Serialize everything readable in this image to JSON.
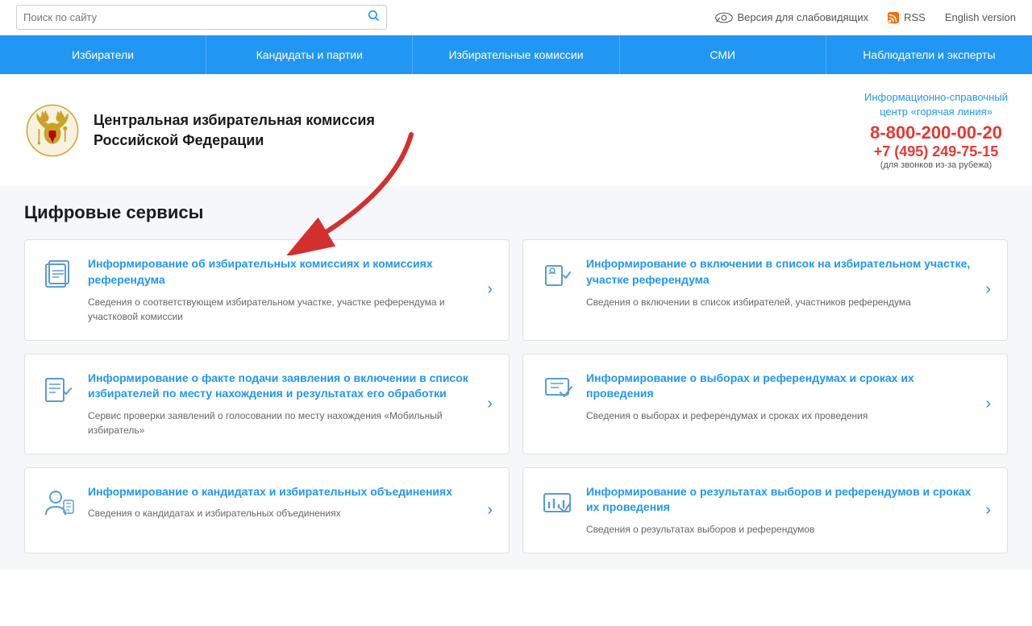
{
  "topbar": {
    "search_placeholder": "Поиск по сайту",
    "vision_label": "Версия для слабовидящих",
    "rss_label": "RSS",
    "english_label": "English version"
  },
  "nav": {
    "items": [
      {
        "label": "Избиратели"
      },
      {
        "label": "Кандидаты и партии"
      },
      {
        "label": "Избирательные комиссии"
      },
      {
        "label": "СМИ"
      },
      {
        "label": "Наблюдатели и эксперты"
      }
    ]
  },
  "header": {
    "org_name_line1": "Центральная избирательная комиссия",
    "org_name_line2": "Российской Федерации",
    "info_center_label": "Информационно-справочный\nцентр «горячая линия»",
    "phone1": "8-800-200-00-20",
    "phone2": "+7 (495) 249-75-15",
    "phone_note": "(для звонков из-за рубежа)"
  },
  "main": {
    "section_title": "Цифровые сервисы",
    "services": [
      {
        "id": "commission-info",
        "title": "Информирование об избирательных комиссиях и комиссиях референдума",
        "desc": "Сведения о соответствующем избирательном участке, участке референдума и участковой комиссии"
      },
      {
        "id": "voter-list-info",
        "title": "Информирование о включении в список на избирательном участке, участке референдума",
        "desc": "Сведения о включении в список избирателей, участников референдума"
      },
      {
        "id": "application-info",
        "title": "Информирование о факте подачи заявления о включении в список избирателей по месту нахождения и результатах его обработки",
        "desc": "Сервис проверки заявлений о голосовании по месту нахождения «Мобильный избиратель»"
      },
      {
        "id": "elections-info",
        "title": "Информирование о выборах и референдумах и сроках их проведения",
        "desc": "Сведения о выборах и референдумах и сроках их проведения"
      },
      {
        "id": "candidates-info",
        "title": "Информирование о кандидатах и избирательных объединениях",
        "desc": "Сведения о кандидатах и избирательных объединениях"
      },
      {
        "id": "results-info",
        "title": "Информирование о результатах выборов и референдумов и сроках их проведения",
        "desc": "Сведения о результатах выборов и референдумов"
      }
    ]
  }
}
